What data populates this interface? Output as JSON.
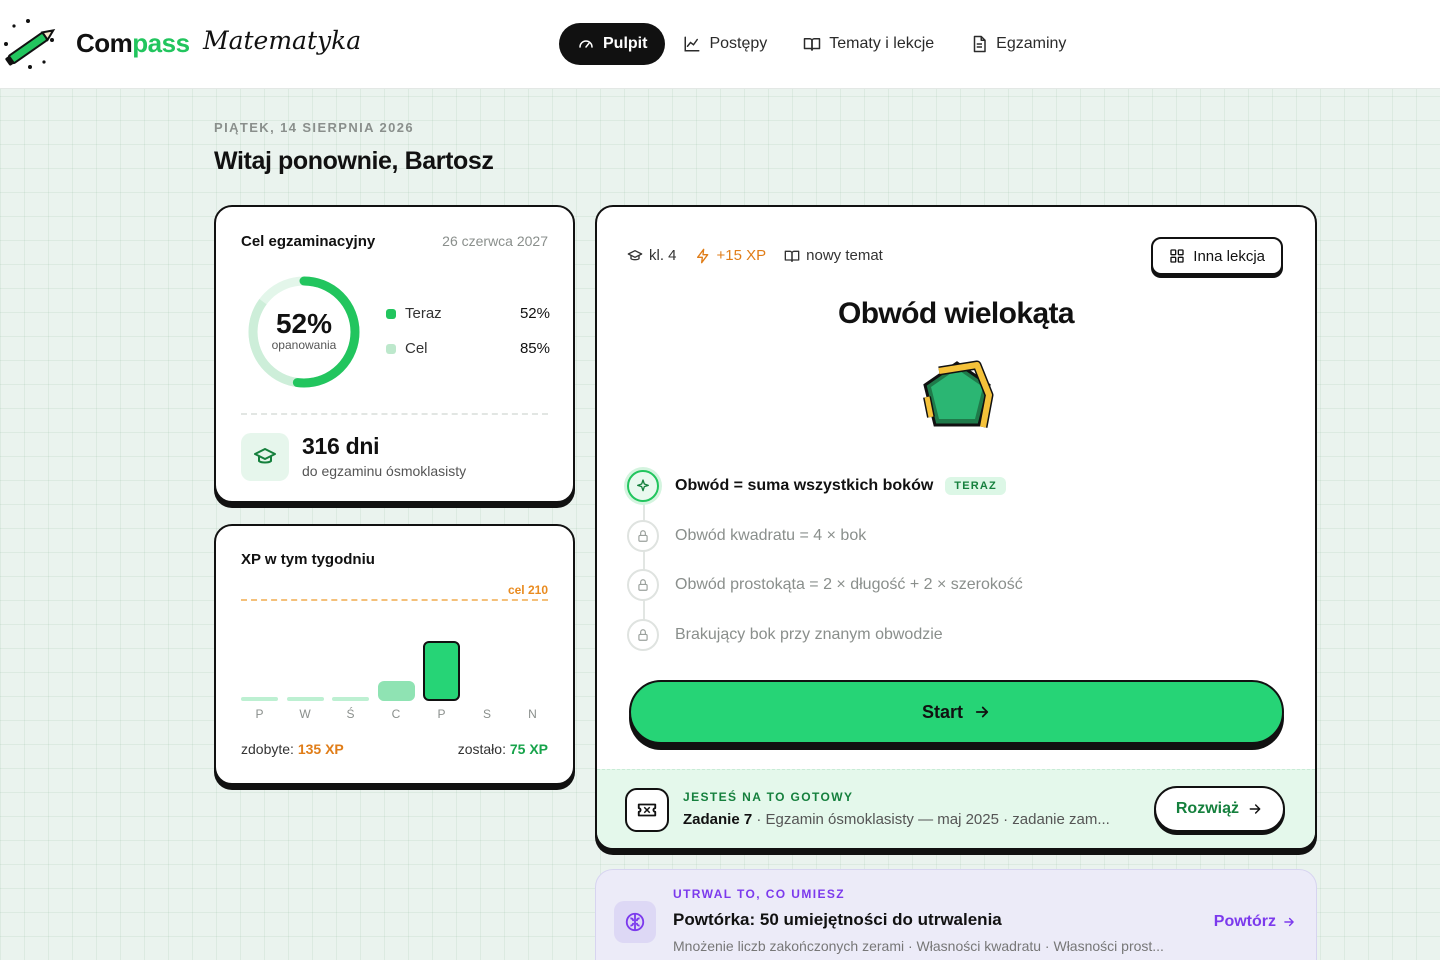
{
  "header": {
    "brand_part1": "Com",
    "brand_part2": "pass",
    "brand_sub": "Matematyka",
    "nav": [
      {
        "label": "Pulpit",
        "icon": "gauge-icon",
        "active": true
      },
      {
        "label": "Postępy",
        "icon": "chart-line-icon",
        "active": false
      },
      {
        "label": "Tematy i lekcje",
        "icon": "book-open-icon",
        "active": false
      },
      {
        "label": "Egzaminy",
        "icon": "document-icon",
        "active": false
      }
    ]
  },
  "date": "PIĄTEK, 14 SIERPNIA 2026",
  "welcome": "Witaj ponownie, Bartosz",
  "goal": {
    "title": "Cel egzaminacyjny",
    "date": "26 czerwca 2027",
    "percent": "52%",
    "percent_value": 52,
    "percent_label": "opanowania",
    "legend": [
      {
        "label": "Teraz",
        "value": "52%",
        "color": "#22c55e"
      },
      {
        "label": "Cel",
        "value": "85%",
        "color": "#bde8cc"
      }
    ],
    "days": "316 dni",
    "days_sub": "do egzaminu ósmoklasisty"
  },
  "xp": {
    "title": "XP w tym tygodniu",
    "goal_label": "cel 210",
    "goal_value": 210,
    "days": [
      "P",
      "W",
      "Ś",
      "C",
      "P",
      "S",
      "N"
    ],
    "values": [
      4,
      4,
      4,
      30,
      90,
      0,
      0
    ],
    "earned_label": "zdobyte:",
    "earned": "135 XP",
    "left_label": "zostało:",
    "left": "75 XP"
  },
  "lesson": {
    "grade": "kl. 4",
    "xp": "+15 XP",
    "tag": "nowy temat",
    "other_button": "Inna lekcja",
    "title": "Obwód wielokąta",
    "steps": [
      {
        "text": "Obwód = suma wszystkich boków",
        "state": "current"
      },
      {
        "text": "Obwód kwadratu = 4 × bok",
        "state": "locked"
      },
      {
        "text": "Obwód prostokąta = 2 × długość + 2 × szerokość",
        "state": "locked"
      },
      {
        "text": "Brakujący bok przy znanym obwodzie",
        "state": "locked"
      }
    ],
    "now_pill": "TERAZ",
    "start_button": "Start",
    "ready": {
      "kicker": "JESTEŚ NA TO GOTOWY",
      "task": "Zadanie 7",
      "detail": " · Egzamin ósmoklasisty — maj 2025 · zadanie zam...",
      "button": "Rozwiąż"
    }
  },
  "review": {
    "kicker": "UTRWAL TO, CO UMIESZ",
    "title": "Powtórka: 50 umiejętności do utrwalenia",
    "sub": "Mnożenie liczb zakończonych zerami · Własności kwadratu · Własności prost...",
    "button": "Powtórz"
  },
  "colors": {
    "accent": "#22c55e",
    "orange": "#e07d18",
    "purple": "#7c3aed"
  }
}
